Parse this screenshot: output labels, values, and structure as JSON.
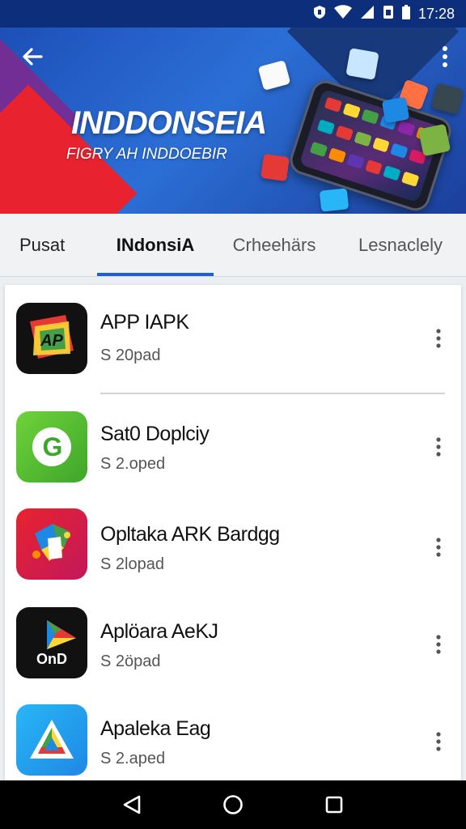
{
  "status_bar": {
    "time": "17:28",
    "icons": [
      "shield-icon",
      "wifi-icon",
      "signal-icon",
      "sim-icon",
      "battery-icon"
    ]
  },
  "hero": {
    "title": "INDDONSEIA",
    "subtitle": "FIGRY AH INDDOEBIR",
    "back_icon": "arrow-left-icon",
    "menu_icon": "more-vertical-icon",
    "colors": {
      "primary": "#1d4fb8",
      "accent_red": "#e8232f",
      "accent_purple": "#7b2a8f"
    }
  },
  "tabs": [
    {
      "label": "Pusat",
      "active": false
    },
    {
      "label": "INdonsiA",
      "active": true
    },
    {
      "label": "Crheehärs",
      "active": false
    },
    {
      "label": "Lesnaclely",
      "active": false
    }
  ],
  "apps": [
    {
      "name": "APP IAPK",
      "size": "S 20pad",
      "icon": "ap-logo-icon",
      "icon_text": "AP"
    },
    {
      "name": "Sat0 Doplciy",
      "size": "S 2.oped",
      "icon": "green-g-icon",
      "icon_text": "G"
    },
    {
      "name": "Opltaka ARK Bardgg",
      "size": "S 2lopad",
      "icon": "colorful-puzzle-icon",
      "icon_text": ""
    },
    {
      "name": "Aplöara AeKJ",
      "size": "S 2öpad",
      "icon": "play-store-icon",
      "icon_text": "OnD"
    },
    {
      "name": "Apaleka Eag",
      "size": "S 2.aped",
      "icon": "triangle-logo-icon",
      "icon_text": ""
    }
  ],
  "nav_bar": {
    "back": "nav-back-icon",
    "home": "nav-home-icon",
    "recents": "nav-recents-icon"
  }
}
